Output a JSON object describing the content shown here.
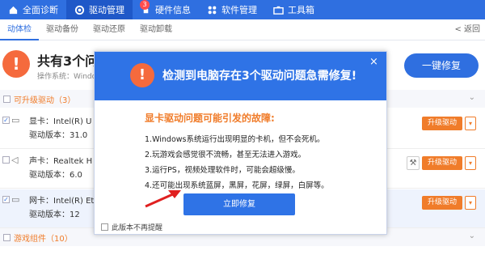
{
  "nav": {
    "items": [
      {
        "label": "全面诊断",
        "icon": "home-icon"
      },
      {
        "label": "驱动管理",
        "icon": "gear-icon",
        "active": true,
        "badge": "3"
      },
      {
        "label": "硬件信息",
        "icon": "rocket-icon"
      },
      {
        "label": "软件管理",
        "icon": "apps-icon"
      },
      {
        "label": "工具箱",
        "icon": "toolbox-icon"
      }
    ]
  },
  "subtabs": {
    "items": [
      "动体检",
      "驱动备份",
      "驱动还原",
      "驱动卸载"
    ],
    "back": "返回"
  },
  "summary": {
    "title": "共有3个问题",
    "subtitle": "操作系统：Windows",
    "fix_all": "一键修复"
  },
  "sections": [
    {
      "label": "可升级驱动（3）"
    },
    {
      "label": "游戏组件（10）"
    }
  ],
  "rows": [
    {
      "line1": "显卡：Intel(R) U",
      "line2": "驱动版本：31.0",
      "action": "升级驱动"
    },
    {
      "line1": "声卡：Realtek H",
      "line2": "驱动版本：6.0",
      "action": "升级驱动"
    },
    {
      "line1": "网卡：Intel(R) Et",
      "line2": "驱动版本：12",
      "action": "升级驱动"
    }
  ],
  "dialog": {
    "title": "检测到电脑存在3个驱动问题急需修复!",
    "subtitle": "显卡驱动问题可能引发的故障:",
    "lines": [
      "1.Windows系统运行出现明显的卡机，但不会死机。",
      "2.玩游戏会感觉很不流畅，甚至无法进入游戏。",
      "3.运行PS，视频处理软件时，可能会超级慢。",
      "4.还可能出现系统蓝屏，黑屏，花屏，绿屏，白屏等。"
    ],
    "button": "立即修复",
    "footer": "此版本不再提醒",
    "close": "×"
  },
  "colors": {
    "primary": "#2f6fe0",
    "warning": "#f56a3d",
    "accent_orange": "#f07c2a"
  }
}
